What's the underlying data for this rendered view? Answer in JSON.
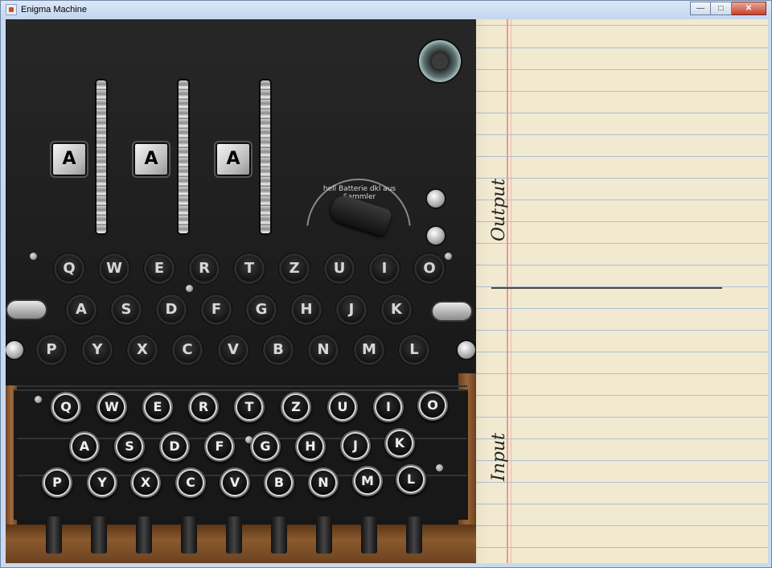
{
  "window": {
    "title": "Enigma Machine",
    "buttons": {
      "minimize": "—",
      "maximize": "□",
      "close": "✕"
    }
  },
  "rotors": [
    "A",
    "A",
    "A"
  ],
  "lampboard": {
    "row1": [
      "Q",
      "W",
      "E",
      "R",
      "T",
      "Z",
      "U",
      "I",
      "O"
    ],
    "row2": [
      "A",
      "S",
      "D",
      "F",
      "G",
      "H",
      "J",
      "K"
    ],
    "row3": [
      "P",
      "Y",
      "X",
      "C",
      "V",
      "B",
      "N",
      "M",
      "L"
    ]
  },
  "keyboard": {
    "row1": [
      "Q",
      "W",
      "E",
      "R",
      "T",
      "Z",
      "U",
      "I",
      "O"
    ],
    "row2": [
      "A",
      "S",
      "D",
      "F",
      "G",
      "H",
      "J",
      "K"
    ],
    "row3": [
      "P",
      "Y",
      "X",
      "C",
      "V",
      "B",
      "N",
      "M",
      "L"
    ]
  },
  "dial_label": "hell Batterie dkl   aus  Sammler",
  "paper": {
    "output_label": "Output",
    "input_label": "Input"
  },
  "colors": {
    "machine": "#1f1f1f",
    "paper": "#f2ead0",
    "ruling": "#a9bfd2",
    "margin": "#e39a96"
  }
}
